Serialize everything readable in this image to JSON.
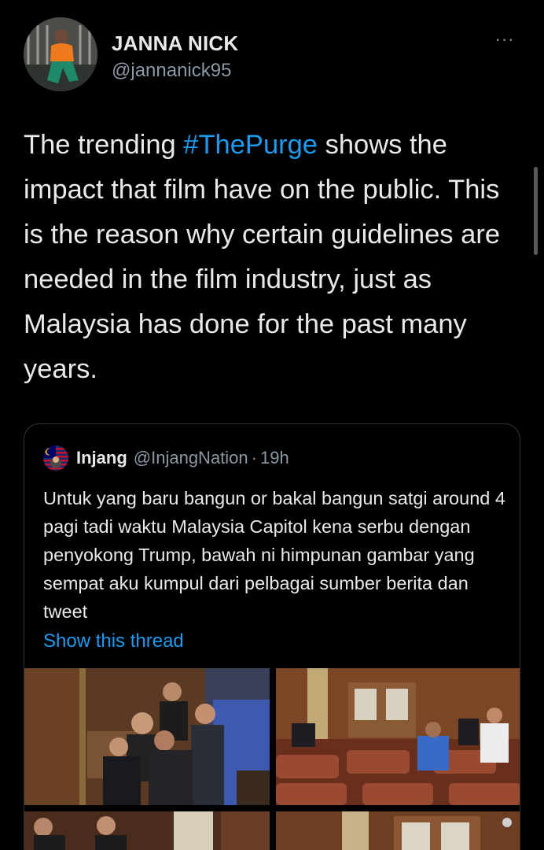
{
  "tweet": {
    "author_name": "JANNA NICK",
    "author_handle": "@jannanick95",
    "more_label": "···",
    "text_parts": [
      "The trending ",
      "#ThePurge",
      " shows the impact that film have on the public. This is the reason why certain guidelines are needed in the film industry, just as Malaysia has done for the past many years."
    ]
  },
  "quoted": {
    "name": "Injang",
    "handle": "@InjangNation",
    "dot": "·",
    "time": "19h",
    "text": "Untuk yang baru bangun or bakal bangun satgi around 4 pagi tadi waktu Malaysia Capitol kena serbu dengan penyokong Trump, bawah ni himpunan gambar yang sempat aku kumpul dari pelbagai sumber berita dan tweet",
    "show_thread": "Show this thread",
    "media": [
      {
        "kind": "photo"
      },
      {
        "kind": "photo"
      },
      {
        "kind": "photo"
      },
      {
        "kind": "photo"
      }
    ]
  },
  "colors": {
    "background": "#000000",
    "link": "#1d9bf0",
    "secondary_text": "#8b98a5",
    "border": "#2f3336"
  }
}
